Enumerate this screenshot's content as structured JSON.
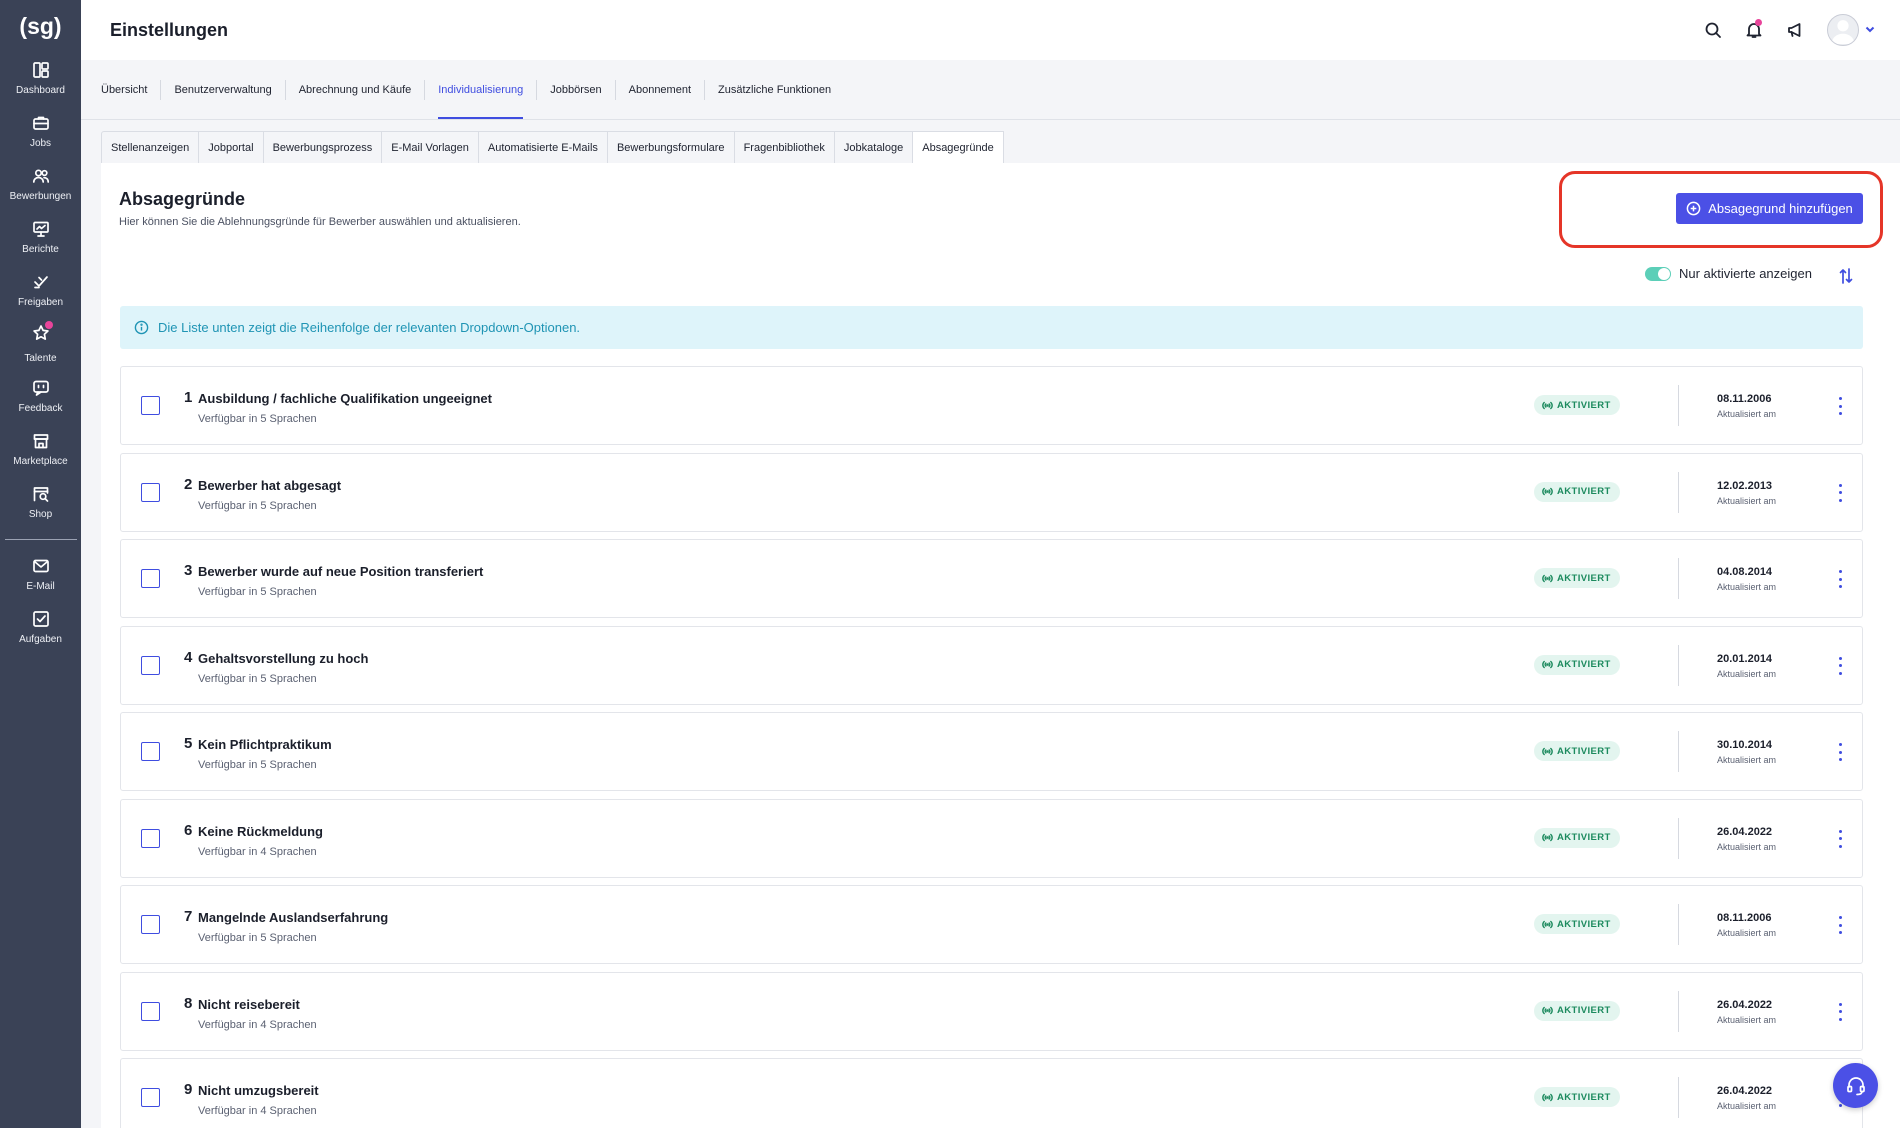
{
  "app": {
    "logo_text": "(sg)"
  },
  "sidebar": {
    "items": [
      {
        "label": "Dashboard",
        "icon": "dashboard-icon"
      },
      {
        "label": "Jobs",
        "icon": "briefcase-icon"
      },
      {
        "label": "Bewerbungen",
        "icon": "users-icon"
      },
      {
        "label": "Berichte",
        "icon": "presentation-chart-icon"
      },
      {
        "label": "Freigaben",
        "icon": "thumbs-up-icon"
      },
      {
        "label": "Talente",
        "icon": "star-icon"
      },
      {
        "label": "Feedback",
        "icon": "message-icon"
      },
      {
        "label": "Marketplace",
        "icon": "store-icon"
      },
      {
        "label": "Shop",
        "icon": "shop-search-icon"
      }
    ],
    "bottom_items": [
      {
        "label": "E-Mail",
        "icon": "mail-icon"
      },
      {
        "label": "Aufgaben",
        "icon": "checkbox-icon"
      }
    ]
  },
  "header": {
    "title": "Einstellungen"
  },
  "main_tabs": [
    "Übersicht",
    "Benutzerverwaltung",
    "Abrechnung und Käufe",
    "Individualisierung",
    "Jobbörsen",
    "Abonnement",
    "Zusätzliche Funktionen"
  ],
  "main_tab_active": "Individualisierung",
  "sub_tabs": [
    "Stellenanzeigen",
    "Jobportal",
    "Bewerbungsprozess",
    "E-Mail Vorlagen",
    "Automatisierte E-Mails",
    "Bewerbungsformulare",
    "Fragenbibliothek",
    "Jobkataloge",
    "Absagegründe"
  ],
  "sub_tab_active": "Absagegründe",
  "section": {
    "title": "Absagegründe",
    "description": "Hier können Sie die Ablehnungsgründe für Bewerber auswählen und aktualisieren.",
    "add_button": "Absagegrund hinzufügen",
    "toggle_label": "Nur aktivierte anzeigen",
    "toggle_on": true,
    "info_text": "Die Liste unten zeigt die Reihenfolge der relevanten Dropdown-Optionen."
  },
  "rows": [
    {
      "num": "1",
      "title": "Ausbildung / fachliche Qualifikation ungeeignet",
      "sub": "Verfügbar in 5 Sprachen",
      "status": "AKTIVIERT",
      "date": "08.11.2006",
      "date_label": "Aktualisiert am"
    },
    {
      "num": "2",
      "title": "Bewerber hat abgesagt",
      "sub": "Verfügbar in 5 Sprachen",
      "status": "AKTIVIERT",
      "date": "12.02.2013",
      "date_label": "Aktualisiert am"
    },
    {
      "num": "3",
      "title": "Bewerber wurde auf neue Position transferiert",
      "sub": "Verfügbar in 5 Sprachen",
      "status": "AKTIVIERT",
      "date": "04.08.2014",
      "date_label": "Aktualisiert am"
    },
    {
      "num": "4",
      "title": "Gehaltsvorstellung zu hoch",
      "sub": "Verfügbar in 5 Sprachen",
      "status": "AKTIVIERT",
      "date": "20.01.2014",
      "date_label": "Aktualisiert am"
    },
    {
      "num": "5",
      "title": "Kein Pflichtpraktikum",
      "sub": "Verfügbar in 5 Sprachen",
      "status": "AKTIVIERT",
      "date": "30.10.2014",
      "date_label": "Aktualisiert am"
    },
    {
      "num": "6",
      "title": "Keine Rückmeldung",
      "sub": "Verfügbar in 4 Sprachen",
      "status": "AKTIVIERT",
      "date": "26.04.2022",
      "date_label": "Aktualisiert am"
    },
    {
      "num": "7",
      "title": "Mangelnde Auslandserfahrung",
      "sub": "Verfügbar in 5 Sprachen",
      "status": "AKTIVIERT",
      "date": "08.11.2006",
      "date_label": "Aktualisiert am"
    },
    {
      "num": "8",
      "title": "Nicht reisebereit",
      "sub": "Verfügbar in 4 Sprachen",
      "status": "AKTIVIERT",
      "date": "26.04.2022",
      "date_label": "Aktualisiert am"
    },
    {
      "num": "9",
      "title": "Nicht umzugsbereit",
      "sub": "Verfügbar in 4 Sprachen",
      "status": "AKTIVIERT",
      "date": "26.04.2022",
      "date_label": "Aktualisiert am"
    }
  ],
  "colors": {
    "sidebar_bg": "#3a4256",
    "accent": "#4b50e6",
    "status_green": "#1c8a5e",
    "info_bg": "#def4fa",
    "highlight_red": "#e53528"
  }
}
